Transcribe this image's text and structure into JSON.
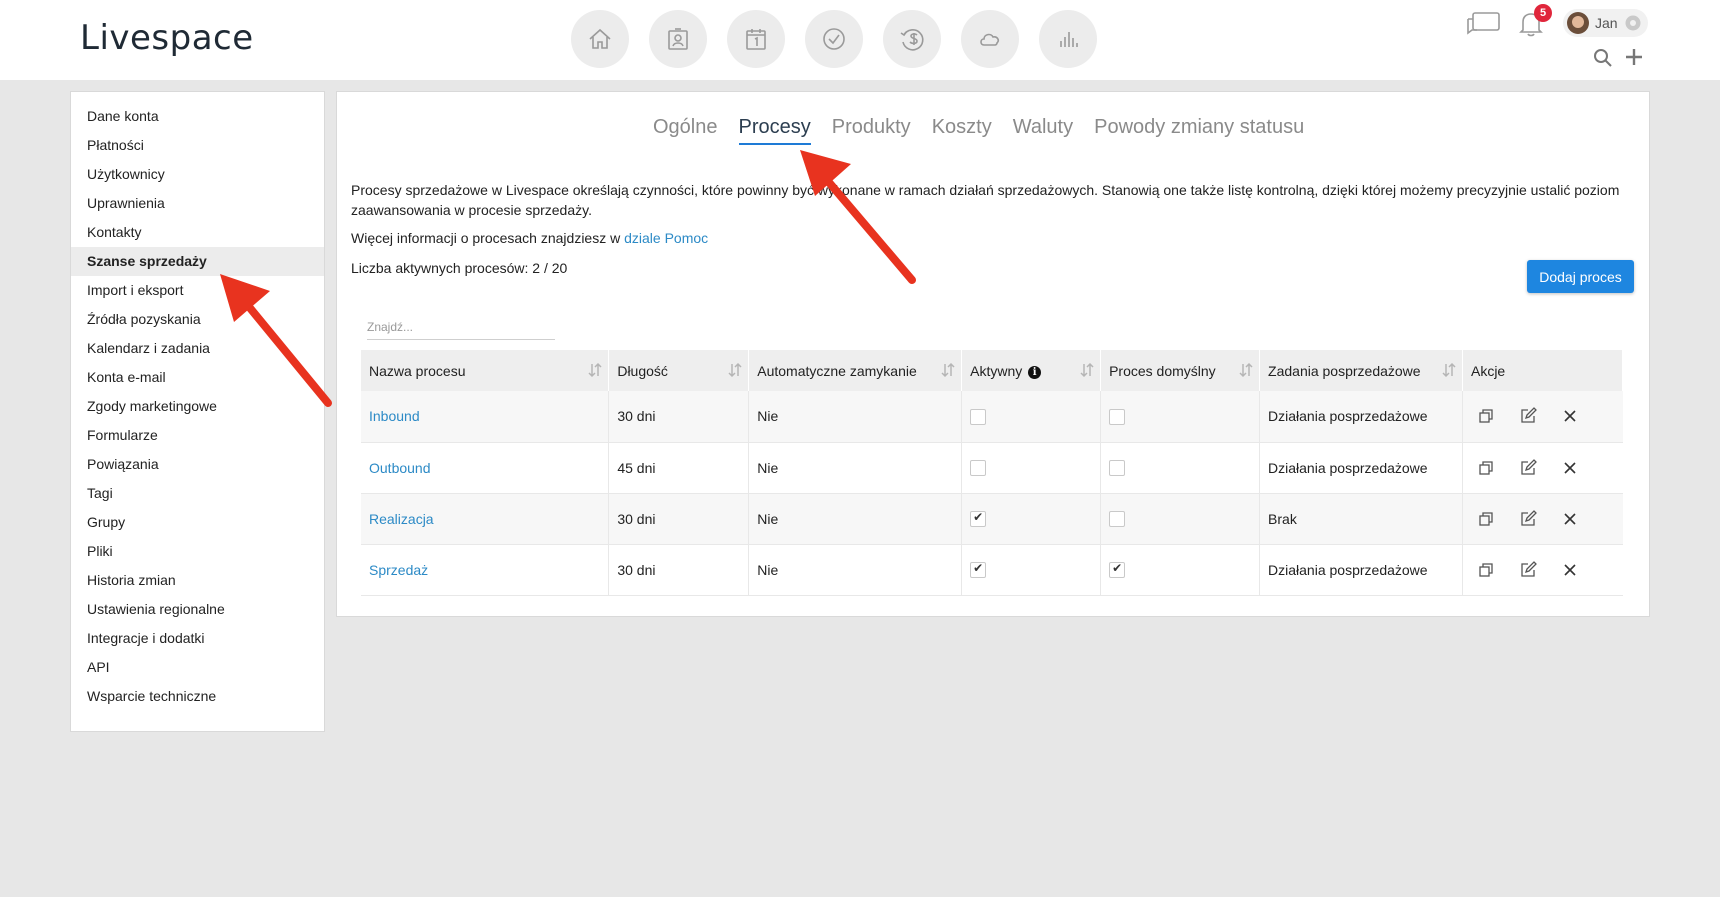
{
  "app": {
    "logo": "Livespace"
  },
  "topnav": {
    "icons": [
      "home-icon",
      "contacts-icon",
      "calendar-icon",
      "tasks-icon",
      "deals-icon",
      "cloud-icon",
      "reports-icon"
    ],
    "notifications_count": "5",
    "user_name": "Jan"
  },
  "sidebar": {
    "items": [
      {
        "label": "Dane konta"
      },
      {
        "label": "Płatności"
      },
      {
        "label": "Użytkownicy"
      },
      {
        "label": "Uprawnienia"
      },
      {
        "label": "Kontakty"
      },
      {
        "label": "Szanse sprzedaży",
        "active": true
      },
      {
        "label": "Import i eksport"
      },
      {
        "label": "Źródła pozyskania"
      },
      {
        "label": "Kalendarz i zadania"
      },
      {
        "label": "Konta e-mail"
      },
      {
        "label": "Zgody marketingowe"
      },
      {
        "label": "Formularze"
      },
      {
        "label": "Powiązania"
      },
      {
        "label": "Tagi"
      },
      {
        "label": "Grupy"
      },
      {
        "label": "Pliki"
      },
      {
        "label": "Historia zmian"
      },
      {
        "label": "Ustawienia regionalne"
      },
      {
        "label": "Integracje i dodatki"
      },
      {
        "label": "API"
      },
      {
        "label": "Wsparcie techniczne"
      }
    ]
  },
  "tabs": [
    {
      "label": "Ogólne"
    },
    {
      "label": "Procesy",
      "active": true
    },
    {
      "label": "Produkty"
    },
    {
      "label": "Koszty"
    },
    {
      "label": "Waluty"
    },
    {
      "label": "Powody zmiany statusu"
    }
  ],
  "main": {
    "description": "Procesy sprzedażowe w Livespace określają czynności, które powinny być wykonane w ramach działań sprzedażowych. Stanowią one także listę kontrolną, dzięki której możemy precyzyjnie ustalić poziom zaawansowania w procesie sprzedaży.",
    "more_info_prefix": "Więcej informacji o procesach znajdziesz w ",
    "more_info_link": "dziale Pomoc",
    "active_count": "Liczba aktywnych procesów: 2 / 20",
    "add_button": "Dodaj proces",
    "search_placeholder": "Znajdź..."
  },
  "table": {
    "headers": [
      "Nazwa procesu",
      "Długość",
      "Automatyczne zamykanie",
      "Aktywny",
      "Proces domyślny",
      "Zadania posprzedażowe",
      "Akcje"
    ],
    "rows": [
      {
        "name": "Inbound",
        "length": "30 dni",
        "auto_close": "Nie",
        "active": false,
        "default": false,
        "after_sales": "Działania posprzedażowe"
      },
      {
        "name": "Outbound",
        "length": "45 dni",
        "auto_close": "Nie",
        "active": false,
        "default": false,
        "after_sales": "Działania posprzedażowe"
      },
      {
        "name": "Realizacja",
        "length": "30 dni",
        "auto_close": "Nie",
        "active": true,
        "default": false,
        "after_sales": "Brak"
      },
      {
        "name": "Sprzedaż",
        "length": "30 dni",
        "auto_close": "Nie",
        "active": true,
        "default": true,
        "after_sales": "Działania posprzedażowe"
      }
    ]
  },
  "colors": {
    "accent": "#1e86e0",
    "link": "#2c8ac6",
    "annotation_arrow": "#e8331f",
    "badge": "#e0263b"
  }
}
